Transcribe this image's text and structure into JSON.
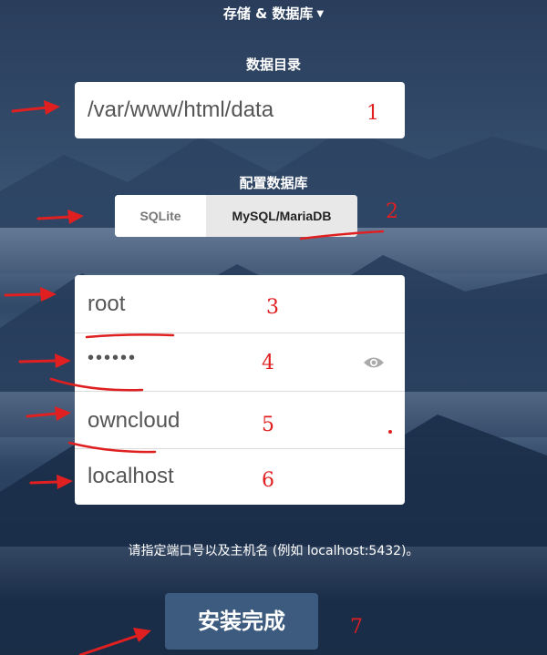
{
  "header": {
    "storage_db_toggle": "存储 & 数据库"
  },
  "data_dir": {
    "label": "数据目录",
    "value": "/var/www/html/data"
  },
  "db_config": {
    "label": "配置数据库",
    "options": [
      "SQLite",
      "MySQL/MariaDB"
    ],
    "selected": "MySQL/MariaDB"
  },
  "db_fields": {
    "user": "root",
    "password": "••••••",
    "name": "owncloud",
    "host": "localhost"
  },
  "hint": "请指定端口号以及主机名 (例如 localhost:5432)。",
  "install_button": "安装完成",
  "annotations": [
    "1",
    "2",
    "3",
    "4",
    "5",
    "6",
    "7"
  ],
  "colors": {
    "annotation": "#e02020",
    "button": "#3c5b7e"
  }
}
